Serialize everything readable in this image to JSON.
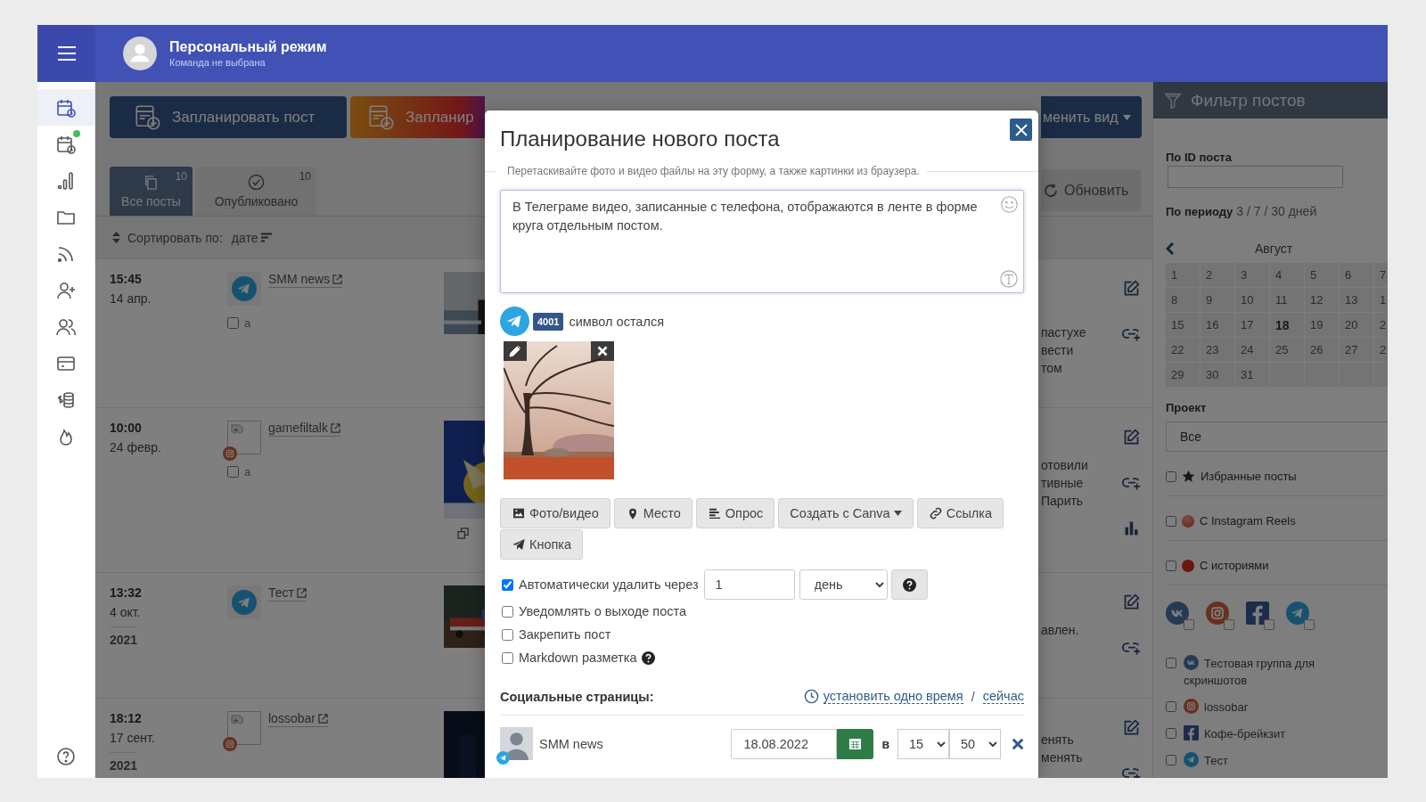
{
  "header": {
    "title": "Персональный режим",
    "subtitle": "Команда не выбрана"
  },
  "sidebar": {
    "items": [
      {
        "kind": "schedule",
        "selected": true,
        "dot": false
      },
      {
        "kind": "schedule",
        "selected": false,
        "dot": true
      },
      {
        "kind": "stats",
        "selected": false,
        "dot": false
      },
      {
        "kind": "folder",
        "selected": false,
        "dot": false
      },
      {
        "kind": "feed",
        "selected": false,
        "dot": false
      },
      {
        "kind": "add-user",
        "selected": false,
        "dot": false
      },
      {
        "kind": "users",
        "selected": false,
        "dot": false
      },
      {
        "kind": "card",
        "selected": false,
        "dot": false
      },
      {
        "kind": "billing",
        "selected": false,
        "dot": false
      },
      {
        "kind": "fire",
        "selected": false,
        "dot": false
      }
    ],
    "bottom_items": [
      {
        "kind": "help",
        "selected": false,
        "dot": false
      }
    ]
  },
  "toolbar": {
    "buttons": [
      {
        "label": "Запланировать пост",
        "kind": "primary"
      },
      {
        "label": "Запланир",
        "kind": "gradient"
      }
    ],
    "view_button": "менить вид",
    "refresh_button": "Обновить"
  },
  "tabs": [
    {
      "label": "Все посты",
      "count": "10",
      "kind": "all",
      "selected": true
    },
    {
      "label": "Опубликовано",
      "count": "10",
      "kind": "published",
      "selected": false
    }
  ],
  "sort": {
    "label": "Сортировать по:",
    "value": "дате"
  },
  "posts": [
    {
      "time": "15:45",
      "date": "14 апр.",
      "kind": "telegram",
      "account": "SMM news",
      "checkbox": {
        "label": "a",
        "checked": false
      },
      "thumbnail": {
        "kind": "picture",
        "gallery": false
      },
      "text": [
        "пастухе",
        "вести",
        "том"
      ],
      "actions": [
        {
          "kind": "edit"
        },
        {
          "kind": "link"
        }
      ]
    },
    {
      "time": "10:00",
      "date": "24 февр.",
      "kind": "instagram",
      "account": "gamefiltalk",
      "checkbox": {
        "label": "a",
        "checked": false
      },
      "thumbnail": {
        "kind": "picture",
        "gallery": true
      },
      "text": [
        "отовили",
        "тивные",
        "Парить"
      ],
      "actions": [
        {
          "kind": "edit"
        },
        {
          "kind": "link"
        },
        {
          "kind": "stats"
        }
      ]
    },
    {
      "time": "13:32",
      "date": "4 окт.",
      "year": "2021",
      "kind": "telegram",
      "account": "Тест",
      "thumbnail": {
        "kind": "picture",
        "gallery": false
      },
      "text": [
        "авлен."
      ],
      "actions": [
        {
          "kind": "edit"
        },
        {
          "kind": "link"
        }
      ]
    },
    {
      "time": "18:12",
      "date": "17 сент.",
      "year": "2021",
      "kind": "instagram",
      "account": "lossobar",
      "thumbnail": {
        "kind": "picture"
      },
      "text": [
        "енять",
        "менять"
      ],
      "actions": [
        {
          "kind": "edit"
        },
        {
          "kind": "link"
        }
      ]
    }
  ],
  "modal": {
    "title": "Планирование нового поста",
    "hint": "Перетаскивайте фото и видео файлы на эту форму, а также картинки из браузера.",
    "text": "В Телеграме видео, записанные с телефона, отображаются в ленте в форме круга отдельным постом.",
    "counter": {
      "kind": "telegram",
      "value": "4001",
      "label": "символ остался"
    },
    "attachments": [
      {
        "kind": "picture"
      }
    ],
    "buttons": [
      {
        "label": "Фото/видео",
        "caret": false
      },
      {
        "label": "Место",
        "kind": "place",
        "caret": false
      },
      {
        "label": "Опрос",
        "kind": "poll",
        "caret": false
      },
      {
        "label": "Создать с Canva",
        "kind": "canva",
        "caret": true
      },
      {
        "label": "Ссылка",
        "kind": "link",
        "caret": false
      },
      {
        "label": "Кнопка",
        "kind": "button",
        "caret": false
      }
    ],
    "options": [
      {
        "label": "Автоматически удалить через",
        "checked": true,
        "kind": "auto-delete"
      },
      {
        "label": "Уведомлять о выходе поста",
        "checked": false,
        "kind": "plain"
      },
      {
        "label": "Закрепить пост",
        "checked": false,
        "kind": "plain"
      },
      {
        "label": "Markdown разметка",
        "checked": false,
        "kind": "help"
      }
    ],
    "auto_delete": {
      "value": "1",
      "unit": "день"
    },
    "social": {
      "label": "Социальные страницы:",
      "set_time": "установить одно время",
      "separator": "/",
      "now": "сейчас"
    },
    "accounts": [
      {
        "name": "SMM news",
        "kind": "telegram",
        "date": "18.08.2022",
        "at": "в",
        "hour": "15",
        "minute": "50"
      }
    ]
  },
  "filter": {
    "title": "Фильтр постов",
    "id_label": "По ID поста",
    "period_label": "По периоду",
    "period_options": "3 / 7 / 30 дней",
    "calendar": {
      "month": "Август",
      "days": [
        {
          "label": "1",
          "selected": false
        },
        {
          "label": "2",
          "selected": false
        },
        {
          "label": "3",
          "selected": false
        },
        {
          "label": "4",
          "selected": false
        },
        {
          "label": "5",
          "selected": false
        },
        {
          "label": "6",
          "selected": false
        },
        {
          "label": "7",
          "selected": false
        },
        {
          "label": "8",
          "selected": false
        },
        {
          "label": "9",
          "selected": false
        },
        {
          "label": "10",
          "selected": false
        },
        {
          "label": "11",
          "selected": false
        },
        {
          "label": "12",
          "selected": false
        },
        {
          "label": "13",
          "selected": false
        },
        {
          "label": "1",
          "selected": false
        },
        {
          "label": "15",
          "selected": false
        },
        {
          "label": "16",
          "selected": false
        },
        {
          "label": "17",
          "selected": false
        },
        {
          "label": "18",
          "selected": true
        },
        {
          "label": "19",
          "selected": false
        },
        {
          "label": "20",
          "selected": false
        },
        {
          "label": "2",
          "selected": false
        },
        {
          "label": "22",
          "selected": false
        },
        {
          "label": "23",
          "selected": false
        },
        {
          "label": "24",
          "selected": false
        },
        {
          "label": "25",
          "selected": false
        },
        {
          "label": "26",
          "selected": false
        },
        {
          "label": "27",
          "selected": false
        },
        {
          "label": "2",
          "selected": false
        },
        {
          "label": "29",
          "selected": false
        },
        {
          "label": "30",
          "selected": false
        },
        {
          "label": "31",
          "selected": false
        }
      ]
    },
    "project_label": "Проект",
    "project_value": "Все",
    "toggles": [
      {
        "kind": "star",
        "label": "Избранные посты",
        "checked": false
      },
      {
        "kind": "reels",
        "label": "С Instagram Reels",
        "checked": false
      },
      {
        "kind": "stories",
        "label": "С историями",
        "checked": false
      }
    ],
    "networks": [
      {
        "kind": "vk",
        "checked": false
      },
      {
        "kind": "instagram",
        "checked": false
      },
      {
        "kind": "facebook",
        "checked": false
      },
      {
        "kind": "telegram",
        "checked": false
      }
    ],
    "accounts": [
      {
        "name": "Тестовая группа для скриншотов",
        "kind": "vk",
        "checked": false
      },
      {
        "name": "lossobar",
        "kind": "instagram",
        "checked": false
      },
      {
        "name": "Кофе-брейкзит",
        "kind": "facebook",
        "checked": false
      },
      {
        "name": "Тест",
        "kind": "telegram",
        "checked": false
      }
    ]
  }
}
